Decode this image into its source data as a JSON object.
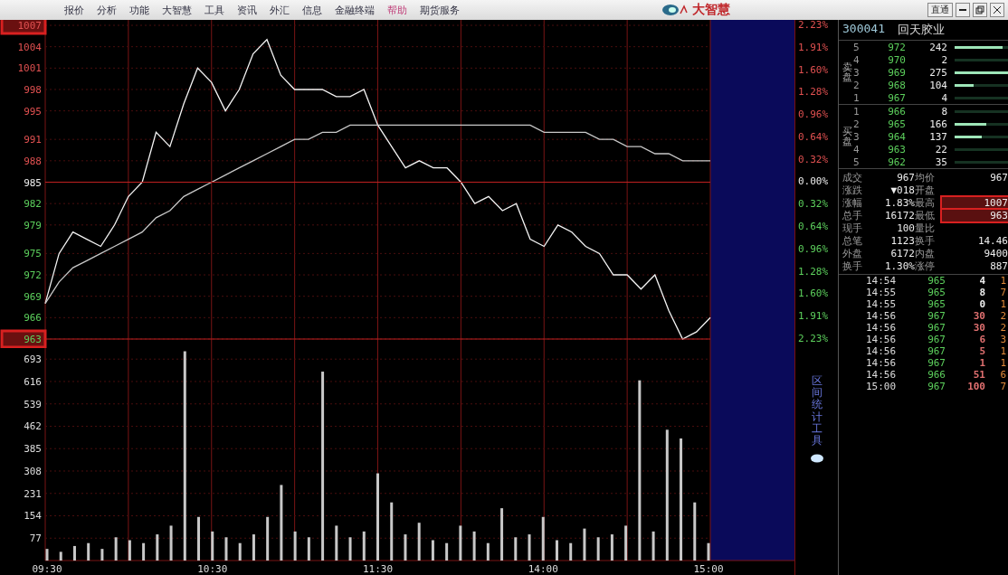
{
  "menu": {
    "items": [
      {
        "label": "报价",
        "selected": false
      },
      {
        "label": "分析",
        "selected": false
      },
      {
        "label": "功能",
        "selected": false
      },
      {
        "label": "大智慧",
        "selected": false
      },
      {
        "label": "工具",
        "selected": false
      },
      {
        "label": "资讯",
        "selected": false
      },
      {
        "label": "外汇",
        "selected": false
      },
      {
        "label": "信息",
        "selected": false
      },
      {
        "label": "金融终端",
        "selected": false
      },
      {
        "label": "帮助",
        "selected": true
      },
      {
        "label": "期货服务",
        "selected": false
      }
    ],
    "brand": "大智慧",
    "shortcut_button": "直通"
  },
  "price_chart": {
    "chart_data": {
      "type": "line",
      "grid": true,
      "series": [
        {
          "color": "#f4f4f4",
          "values": [
            968,
            975,
            978,
            977,
            976,
            979,
            983,
            985,
            992,
            990,
            996,
            1001,
            999,
            995,
            998,
            1003,
            1005,
            1000,
            998,
            998,
            998,
            997,
            997,
            998,
            993,
            990,
            987,
            988,
            987,
            987,
            985,
            982,
            983,
            981,
            982,
            977,
            976,
            979,
            978,
            976,
            975,
            972,
            972,
            970,
            972,
            967,
            963,
            964,
            966
          ]
        },
        {
          "color": "#c8c8c8",
          "values": [
            968,
            971,
            973,
            974,
            975,
            976,
            977,
            978,
            980,
            981,
            983,
            984,
            985,
            986,
            987,
            988,
            989,
            990,
            991,
            991,
            992,
            992,
            993,
            993,
            993,
            993,
            993,
            993,
            993,
            993,
            993,
            993,
            993,
            993,
            993,
            993,
            992,
            992,
            992,
            992,
            991,
            991,
            990,
            990,
            989,
            989,
            988,
            988,
            988
          ]
        }
      ],
      "ylim": [
        963,
        1007
      ],
      "yticks": [
        1007,
        1004,
        1001,
        998,
        995,
        991,
        988,
        985,
        982,
        979,
        975,
        972,
        969,
        966,
        963
      ]
    },
    "tick_highlighted": [
      true,
      false,
      false,
      false,
      false,
      false,
      false,
      false,
      false,
      false,
      false,
      false,
      false,
      false,
      true
    ],
    "percent_labels": [
      "2.23%",
      "1.91%",
      "1.60%",
      "1.28%",
      "0.96%",
      "0.64%",
      "0.32%",
      "0.00%",
      "0.32%",
      "0.64%",
      "0.96%",
      "1.28%",
      "1.60%",
      "1.91%",
      "2.23%"
    ]
  },
  "volume_chart": {
    "chart_data": {
      "type": "bar",
      "categories": [
        "09:30",
        null,
        null,
        null,
        null,
        null,
        null,
        null,
        null,
        null,
        null,
        null,
        "10:30",
        null,
        null,
        null,
        null,
        null,
        null,
        null,
        null,
        null,
        null,
        null,
        "11:30",
        null,
        null,
        null,
        null,
        null,
        null,
        null,
        null,
        null,
        null,
        null,
        "14:00",
        null,
        null,
        null,
        null,
        null,
        null,
        null,
        null,
        null,
        null,
        null,
        "15:00"
      ],
      "values": [
        40,
        30,
        50,
        60,
        40,
        80,
        70,
        60,
        90,
        120,
        720,
        150,
        100,
        80,
        60,
        90,
        150,
        260,
        100,
        80,
        650,
        120,
        80,
        100,
        300,
        200,
        90,
        130,
        70,
        60,
        120,
        100,
        60,
        180,
        80,
        90,
        150,
        70,
        60,
        110,
        80,
        90,
        120,
        620,
        100,
        450,
        420,
        200,
        60
      ],
      "ylim": [
        0,
        731
      ],
      "grid": true,
      "yticks": [
        693,
        616,
        539,
        462,
        385,
        308,
        231,
        154,
        77
      ]
    },
    "side_title": "区间统计工具"
  },
  "quote": {
    "code": "300041",
    "name": "回天胶业",
    "sell_title": "卖盘",
    "buy_title": "买盘",
    "sell": [
      {
        "rank": "5",
        "price": "972",
        "volume": "242",
        "level": 0.9
      },
      {
        "rank": "4",
        "price": "970",
        "volume": "2"
      },
      {
        "rank": "3",
        "price": "969",
        "volume": "275",
        "level": 1
      },
      {
        "rank": "2",
        "price": "968",
        "volume": "104",
        "level": 0.35
      },
      {
        "rank": "1",
        "price": "967",
        "volume": "4"
      }
    ],
    "buy": [
      {
        "rank": "1",
        "price": "966",
        "volume": "8"
      },
      {
        "rank": "2",
        "price": "965",
        "volume": "166",
        "level": 0.6
      },
      {
        "rank": "3",
        "price": "964",
        "volume": "137",
        "level": 0.5
      },
      {
        "rank": "4",
        "price": "963",
        "volume": "22"
      },
      {
        "rank": "5",
        "price": "962",
        "volume": "35"
      }
    ],
    "stats": [
      {
        "label": "成交",
        "value": "967",
        "label_2": "均价",
        "value_2": "967",
        "highlighted": false
      },
      {
        "label": "涨跌",
        "value": "▼018",
        "label_2": "开盘",
        "highlighted": false
      },
      {
        "label": "涨幅",
        "value": "1.83%",
        "label_2": "最高",
        "value_2": "1007",
        "highlighted": true
      },
      {
        "label": "总手",
        "value": "16172",
        "label_2": "最低",
        "value_2": "963",
        "highlighted": true
      },
      {
        "label": "现手",
        "value": "100",
        "label_2": "量比",
        "highlighted": false
      },
      {
        "label": "总笔",
        "value": "1123",
        "label_2": "换手",
        "value_2": "14.46",
        "highlighted": false
      },
      {
        "label": "外盘",
        "value": "6172",
        "label_2": "内盘",
        "value_2": "9400",
        "highlighted": false
      },
      {
        "label": "换手",
        "value": "1.30%",
        "label_2": "涨停",
        "value_2": "887",
        "highlighted": false
      }
    ],
    "ticks": [
      {
        "time": "14:54",
        "price": "965",
        "volume": "4",
        "color": "#eeeeee",
        "column_5": "1"
      },
      {
        "time": "14:55",
        "price": "965",
        "volume": "8",
        "color": "#eeeeee",
        "column_5": "7"
      },
      {
        "time": "14:55",
        "price": "965",
        "volume": "0",
        "color": "#eeeeee",
        "column_5": "1"
      },
      {
        "time": "14:56",
        "price": "967",
        "volume": "30",
        "color": "#e07070",
        "column_5": "2"
      },
      {
        "time": "14:56",
        "price": "967",
        "volume": "30",
        "color": "#e07070",
        "column_5": "2"
      },
      {
        "time": "14:56",
        "price": "967",
        "volume": "6",
        "color": "#e07070",
        "column_5": "3"
      },
      {
        "time": "14:56",
        "price": "967",
        "volume": "5",
        "color": "#e07070",
        "column_5": "1"
      },
      {
        "time": "14:56",
        "price": "967",
        "volume": "1",
        "color": "#e07070",
        "column_5": "1"
      },
      {
        "time": "14:56",
        "price": "966",
        "volume": "51",
        "color": "#e07070",
        "column_5": "6"
      },
      {
        "time": "15:00",
        "price": "967",
        "volume": "100",
        "color": "#e07070",
        "column_5": "7"
      }
    ]
  }
}
